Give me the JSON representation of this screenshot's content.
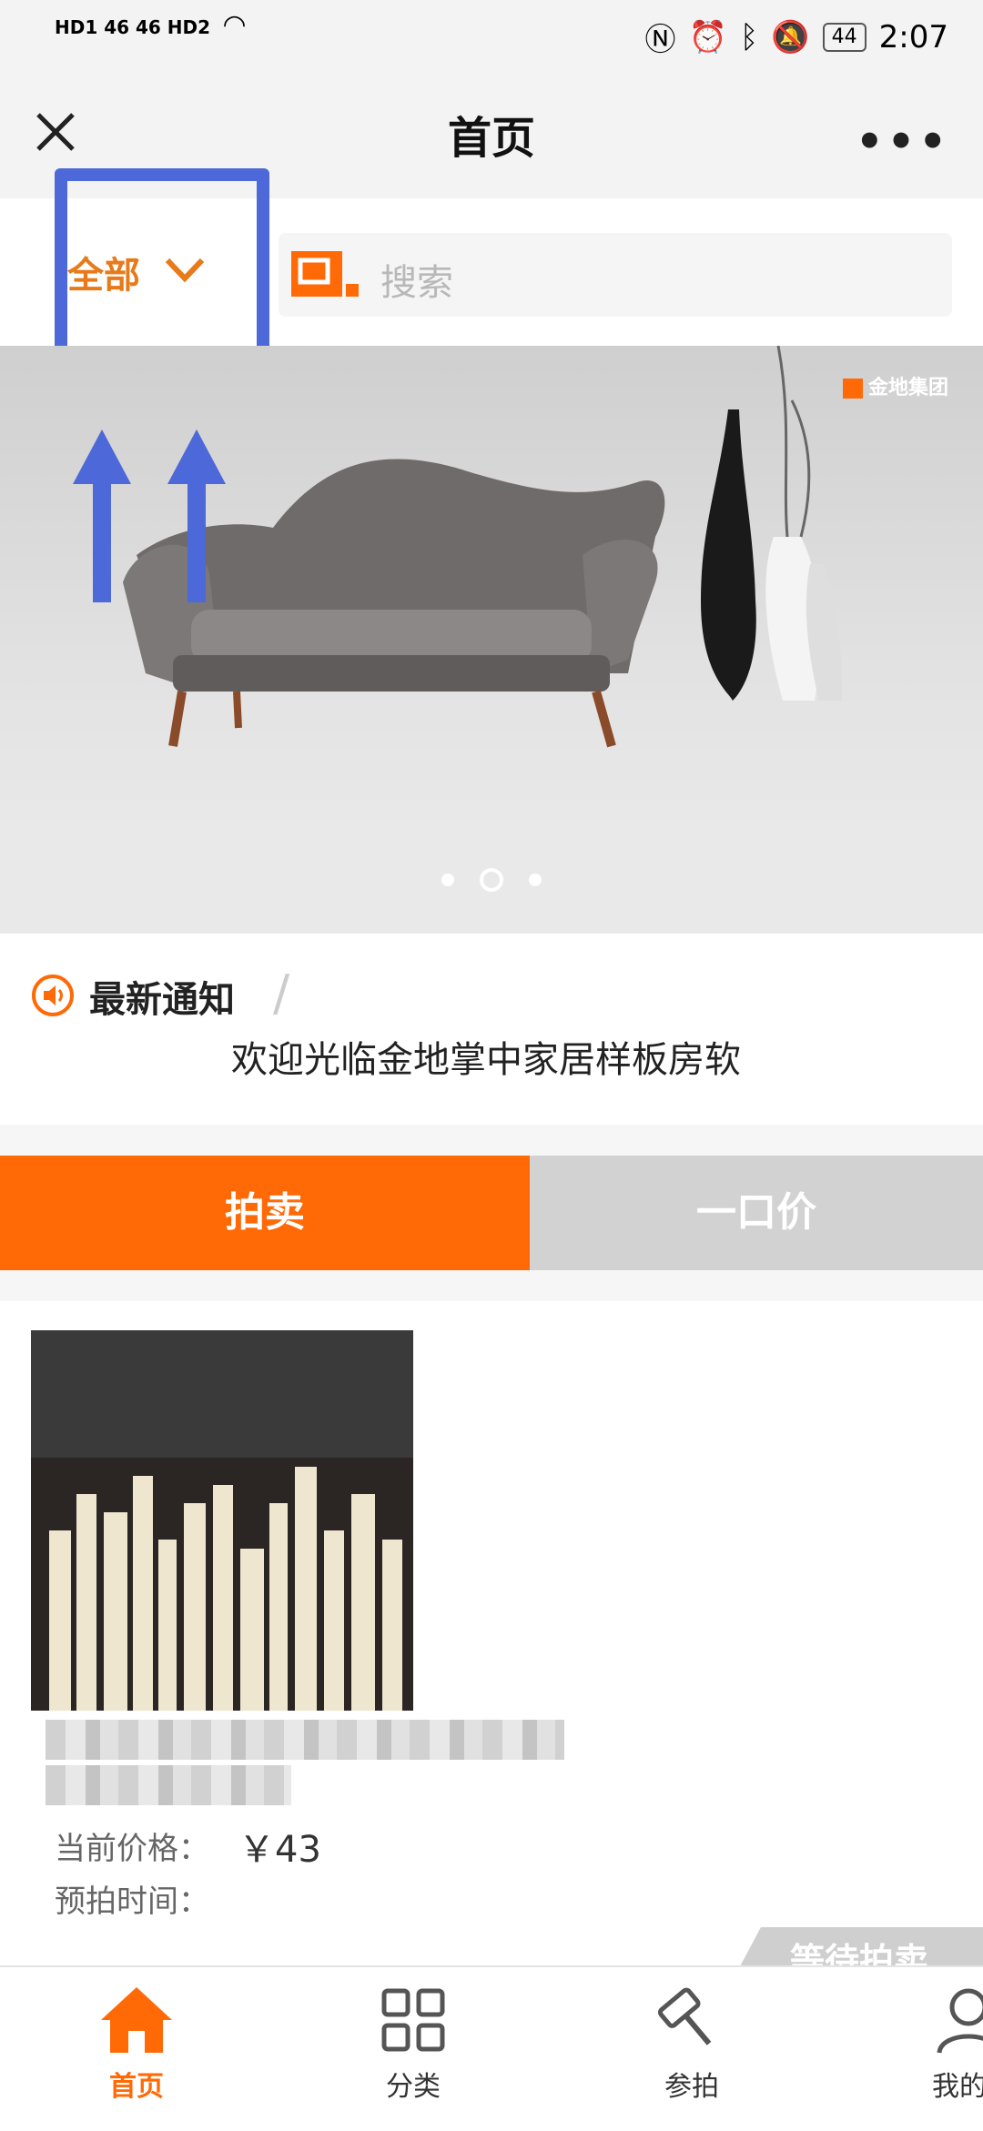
{
  "status_bar": {
    "left_indicators": "HD1 46 46 HD2",
    "battery": "44",
    "time": "2:07"
  },
  "header": {
    "title": "首页"
  },
  "search": {
    "category": "全部",
    "placeholder": "搜索"
  },
  "banner": {
    "brand": "金地集团",
    "slide_count": 3,
    "active_slide": 2
  },
  "notice": {
    "label": "最新通知",
    "text": "欢迎光临金地掌中家居样板房软"
  },
  "tabs": {
    "auction": "拍卖",
    "fixed_price": "一口价"
  },
  "product": {
    "price_label": "当前价格：",
    "price_value": "￥43",
    "time_label": "预拍时间：",
    "ribbon": "等待拍卖"
  },
  "tabbar": {
    "items": [
      {
        "label": "首页",
        "icon": "home-icon",
        "active": true
      },
      {
        "label": "分类",
        "icon": "category-grid-icon",
        "active": false
      },
      {
        "label": "参拍",
        "icon": "auction-hammer-icon",
        "active": false
      },
      {
        "label": "我的",
        "icon": "user-icon",
        "active": false
      }
    ]
  },
  "colors": {
    "accent": "#ff6a07",
    "highlight": "#4d68d8",
    "inactive_tab": "#d2d2d2"
  }
}
